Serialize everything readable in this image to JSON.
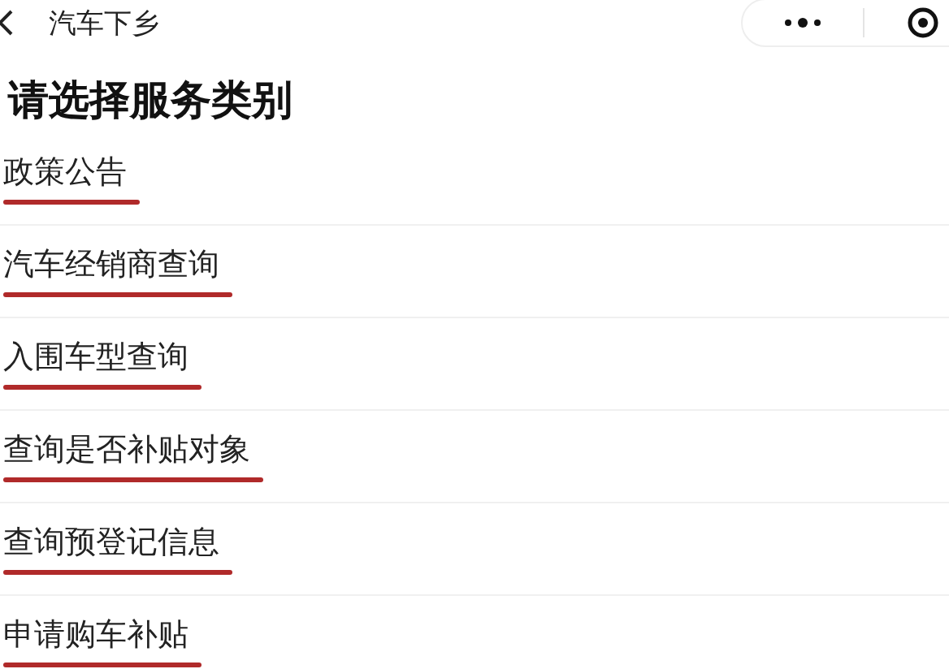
{
  "nav_bar": {
    "title": "汽车下乡"
  },
  "heading": "请选择服务类别",
  "services": [
    {
      "label": "政策公告",
      "underlined": true
    },
    {
      "label": "汽车经销商查询",
      "underlined": true
    },
    {
      "label": "入围车型查询",
      "underlined": true
    },
    {
      "label": "查询是否补贴对象",
      "underlined": true
    },
    {
      "label": "查询预登记信息",
      "underlined": true
    },
    {
      "label": "申请购车补贴",
      "underlined": true
    }
  ]
}
